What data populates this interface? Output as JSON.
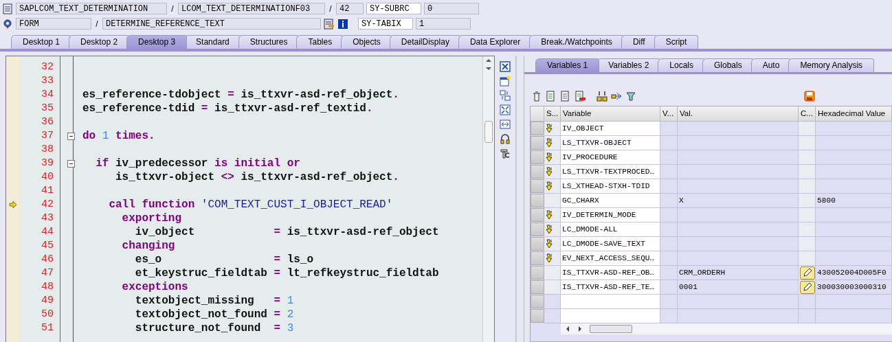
{
  "header": {
    "row_1": {
      "program": "SAPLCOM_TEXT_DETERMINATION",
      "separator_1": "/",
      "include": "LCOM_TEXT_DETERMINATIONF03",
      "separator_2": "/",
      "line": "42",
      "field_name": "SY-SUBRC",
      "field_value": "0"
    },
    "row_2": {
      "event_type": "FORM",
      "separator": "/",
      "event": "DETERMINE_REFERENCE_TEXT",
      "field_name": "SY-TABIX",
      "field_value": "1"
    }
  },
  "desktop_tabs": [
    {
      "label": "Desktop 1",
      "selected": false
    },
    {
      "label": "Desktop 2",
      "selected": false
    },
    {
      "label": "Desktop 3",
      "selected": true
    },
    {
      "label": "Standard",
      "selected": false
    },
    {
      "label": "Structures",
      "selected": false
    },
    {
      "label": "Tables",
      "selected": false
    },
    {
      "label": "Objects",
      "selected": false
    },
    {
      "label": "DetailDisplay",
      "selected": false
    },
    {
      "label": "Data Explorer",
      "selected": false
    },
    {
      "label": "Break./Watchpoints",
      "selected": false
    },
    {
      "label": "Diff",
      "selected": false
    },
    {
      "label": "Script",
      "selected": false
    }
  ],
  "code": [
    {
      "number": "32",
      "current": false,
      "foldable": false
    },
    {
      "number": "33",
      "current": false,
      "foldable": false
    },
    {
      "number": "34",
      "current": false,
      "foldable": false,
      "tokens": [
        {
          "kind": "id",
          "text": "es_reference-tdobject "
        },
        {
          "kind": "op",
          "text": "="
        },
        {
          "kind": "id",
          "text": " is_ttxvr-asd-ref_object"
        },
        {
          "kind": "op",
          "text": "."
        }
      ]
    },
    {
      "number": "35",
      "current": false,
      "foldable": false,
      "tokens": [
        {
          "kind": "id",
          "text": "es_reference-tdid "
        },
        {
          "kind": "op",
          "text": "="
        },
        {
          "kind": "id",
          "text": " is_ttxvr-asd-ref_textid"
        },
        {
          "kind": "op",
          "text": "."
        }
      ]
    },
    {
      "number": "36",
      "current": false,
      "foldable": false
    },
    {
      "number": "37",
      "current": false,
      "foldable": true,
      "tokens": [
        {
          "kind": "kw",
          "text": "do "
        },
        {
          "kind": "num",
          "text": "1"
        },
        {
          "kind": "kw",
          "text": " times."
        }
      ]
    },
    {
      "number": "38",
      "current": false,
      "foldable": false
    },
    {
      "number": "39",
      "current": false,
      "foldable": true,
      "tokens": [
        {
          "kind": "kw",
          "text": "  if "
        },
        {
          "kind": "id",
          "text": "iv_predecessor "
        },
        {
          "kind": "kw",
          "text": "is initial or"
        }
      ]
    },
    {
      "number": "40",
      "current": false,
      "foldable": false,
      "tokens": [
        {
          "kind": "id",
          "text": "     is_ttxvr-object "
        },
        {
          "kind": "op",
          "text": "<>"
        },
        {
          "kind": "id",
          "text": " is_ttxvr-asd-ref_object"
        },
        {
          "kind": "op",
          "text": "."
        }
      ]
    },
    {
      "number": "41",
      "current": false,
      "foldable": false
    },
    {
      "number": "42",
      "current": true,
      "foldable": false,
      "tokens": [
        {
          "kind": "kw",
          "text": "    call function "
        },
        {
          "kind": "str",
          "text": "'COM_TEXT_CUST_I_OBJECT_READ'"
        }
      ]
    },
    {
      "number": "43",
      "current": false,
      "foldable": false,
      "tokens": [
        {
          "kind": "kw",
          "text": "      exporting"
        }
      ]
    },
    {
      "number": "44",
      "current": false,
      "foldable": false,
      "tokens": [
        {
          "kind": "id",
          "text": "        iv_object            "
        },
        {
          "kind": "op",
          "text": "="
        },
        {
          "kind": "id",
          "text": " is_ttxvr-asd-ref_object"
        }
      ]
    },
    {
      "number": "45",
      "current": false,
      "foldable": false,
      "tokens": [
        {
          "kind": "kw",
          "text": "      changing"
        }
      ]
    },
    {
      "number": "46",
      "current": false,
      "foldable": false,
      "tokens": [
        {
          "kind": "id",
          "text": "        es_o                 "
        },
        {
          "kind": "op",
          "text": "="
        },
        {
          "kind": "id",
          "text": " ls_o"
        }
      ]
    },
    {
      "number": "47",
      "current": false,
      "foldable": false,
      "tokens": [
        {
          "kind": "id",
          "text": "        et_keystruc_fieldtab "
        },
        {
          "kind": "op",
          "text": "="
        },
        {
          "kind": "id",
          "text": " lt_refkeystruc_fieldtab"
        }
      ]
    },
    {
      "number": "48",
      "current": false,
      "foldable": false,
      "tokens": [
        {
          "kind": "kw",
          "text": "      exceptions"
        }
      ]
    },
    {
      "number": "49",
      "current": false,
      "foldable": false,
      "tokens": [
        {
          "kind": "id",
          "text": "        textobject_missing   "
        },
        {
          "kind": "op",
          "text": "= "
        },
        {
          "kind": "num",
          "text": "1"
        }
      ]
    },
    {
      "number": "50",
      "current": false,
      "foldable": false,
      "tokens": [
        {
          "kind": "id",
          "text": "        textobject_not_found "
        },
        {
          "kind": "op",
          "text": "= "
        },
        {
          "kind": "num",
          "text": "2"
        }
      ]
    },
    {
      "number": "51",
      "current": false,
      "foldable": false,
      "tokens": [
        {
          "kind": "id",
          "text": "        structure_not_found  "
        },
        {
          "kind": "op",
          "text": "= "
        },
        {
          "kind": "num",
          "text": "3"
        }
      ]
    }
  ],
  "variable_tabs": [
    {
      "label": "Variables 1",
      "selected": true
    },
    {
      "label": "Variables 2",
      "selected": false
    },
    {
      "label": "Locals",
      "selected": false
    },
    {
      "label": "Globals",
      "selected": false
    },
    {
      "label": "Auto",
      "selected": false
    },
    {
      "label": "Memory Analysis",
      "selected": false
    }
  ],
  "variables": {
    "columns": [
      "S...",
      "Variable",
      "V...",
      "Val.",
      "C...",
      "Hexadecimal Value"
    ],
    "rows": [
      {
        "changed": true,
        "variable": "IV_OBJECT",
        "editable": false
      },
      {
        "changed": true,
        "variable": "LS_TTXVR-OBJECT",
        "editable": false
      },
      {
        "changed": true,
        "variable": "IV_PROCEDURE",
        "editable": false
      },
      {
        "changed": true,
        "variable": "LS_TTXVR-TEXTPROCED…",
        "editable": false
      },
      {
        "changed": true,
        "variable": "LS_XTHEAD-STXH-TDID",
        "editable": false
      },
      {
        "changed": false,
        "variable": "GC_CHARX",
        "value": "X",
        "hex": "5800",
        "editable": false
      },
      {
        "changed": true,
        "variable": "IV_DETERMIN_MODE",
        "editable": false
      },
      {
        "changed": true,
        "variable": "LC_DMODE-ALL",
        "editable": false
      },
      {
        "changed": true,
        "variable": "LC_DMODE-SAVE_TEXT",
        "editable": false
      },
      {
        "changed": true,
        "variable": "EV_NEXT_ACCESS_SEQU…",
        "editable": false
      },
      {
        "changed": false,
        "variable": "IS_TTXVR-ASD-REF_OB…",
        "value": "CRM_ORDERH",
        "hex": "430052004D005F0",
        "editable": true
      },
      {
        "changed": false,
        "variable": "IS_TTXVR-ASD-REF_TE…",
        "value": "0001",
        "hex": "300030003000310",
        "editable": true
      }
    ]
  }
}
